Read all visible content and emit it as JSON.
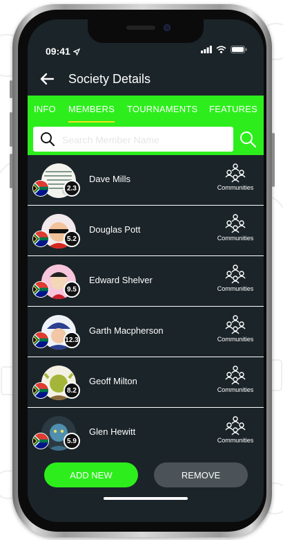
{
  "status_bar": {
    "time": "09:41"
  },
  "header": {
    "title": "Society Details"
  },
  "tabs": [
    {
      "label": "INFO",
      "active": false
    },
    {
      "label": "MEMBERS",
      "active": true
    },
    {
      "label": "TOURNAMENTS",
      "active": false
    },
    {
      "label": "FEATURES",
      "active": false
    }
  ],
  "search": {
    "placeholder": "Search Member Name",
    "value": ""
  },
  "members": [
    {
      "name": "Dave Mills",
      "handicap": "2.3",
      "avatar_icon": "notes-avatar-icon",
      "link_label": "Communities"
    },
    {
      "name": "Douglas Pott",
      "handicap": "5.2",
      "avatar_icon": "superhero-avatar-icon",
      "link_label": "Communities"
    },
    {
      "name": "Edward Shelver",
      "handicap": "9.5",
      "avatar_icon": "cartoon-avatar-icon",
      "link_label": "Communities"
    },
    {
      "name": "Garth Macpherson",
      "handicap": "12.3",
      "avatar_icon": "police-cartoon-avatar-icon",
      "link_label": "Communities"
    },
    {
      "name": "Geoff Milton",
      "handicap": "8.2",
      "avatar_icon": "ogre-avatar-icon",
      "link_label": "Communities"
    },
    {
      "name": "Glen Hewitt",
      "handicap": "5.9",
      "avatar_icon": "alien-avatar-icon",
      "link_label": "Communities"
    }
  ],
  "footer": {
    "add_label": "ADD NEW",
    "remove_label": "REMOVE"
  },
  "colors": {
    "accent": "#2dee1c",
    "tab_underline": "#f3e21a",
    "background": "#1b2429",
    "remove_button": "#4b5358"
  }
}
